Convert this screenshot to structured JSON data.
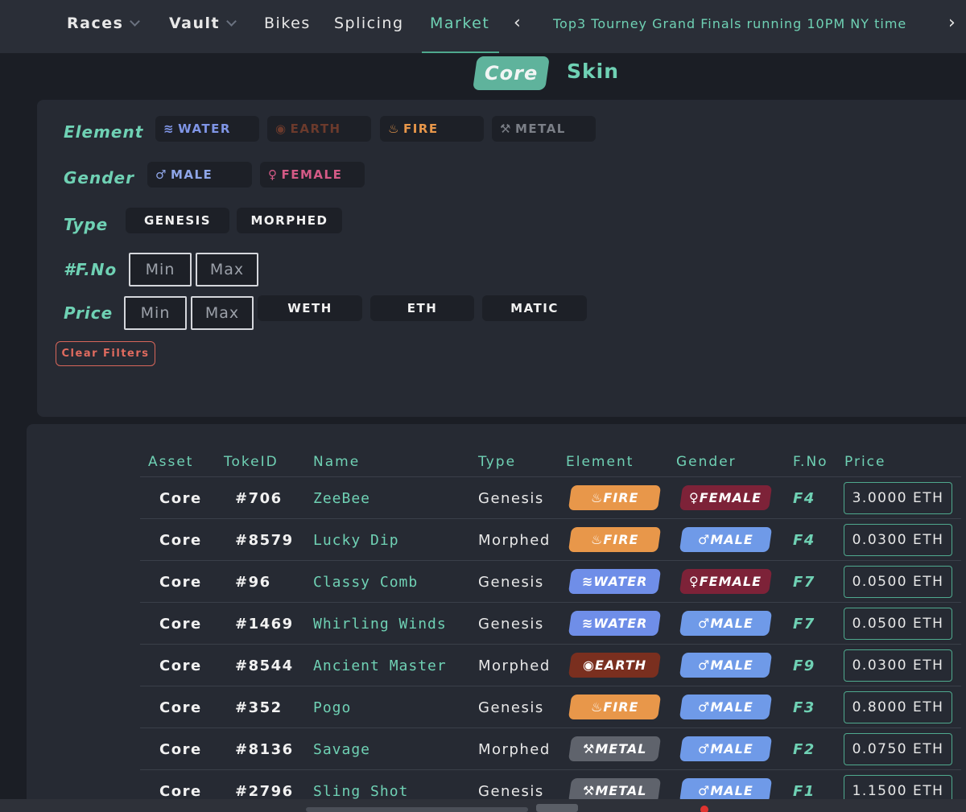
{
  "nav": {
    "races": "Races",
    "vault": "Vault",
    "bikes": "Bikes",
    "splicing": "Splicing",
    "market": "Market",
    "prev": "‹",
    "next": "›",
    "ticker": "Top3 Tourney Grand Finals running 10PM NY time"
  },
  "toggle": {
    "core": "Core",
    "skin": "Skin"
  },
  "filters": {
    "element_label": "Element",
    "gender_label": "Gender",
    "type_label": "Type",
    "fno_label": "#F.No",
    "price_label": "Price",
    "elements": [
      {
        "label": "WATER",
        "icon": "≋",
        "color": "#7f95e6"
      },
      {
        "label": "EARTH",
        "icon": "◉",
        "color": "#6b3a2c"
      },
      {
        "label": "FIRE",
        "icon": "♨",
        "color": "#e8974a"
      },
      {
        "label": "METAL",
        "icon": "⚒",
        "color": "#7b7f87"
      }
    ],
    "genders": [
      {
        "label": "MALE",
        "icon": "♂",
        "color": "#8fa6e8"
      },
      {
        "label": "FEMALE",
        "icon": "♀",
        "color": "#d45a86"
      }
    ],
    "types": [
      "GENESIS",
      "MORPHED"
    ],
    "min_placeholder": "Min",
    "max_placeholder": "Max",
    "currencies": [
      "WETH",
      "ETH",
      "MATIC"
    ],
    "clear": "Clear Filters"
  },
  "table": {
    "headers": [
      "Asset",
      "TokeID",
      "Name",
      "Type",
      "Element",
      "Gender",
      "F.No",
      "Price"
    ],
    "rows": [
      {
        "asset": "Core",
        "id": "#706",
        "name": "ZeeBee",
        "type": "Genesis",
        "element": "FIRE",
        "gender": "FEMALE",
        "fno": "F4",
        "price": "3.0000 ETH"
      },
      {
        "asset": "Core",
        "id": "#8579",
        "name": "Lucky Dip",
        "type": "Morphed",
        "element": "FIRE",
        "gender": "MALE",
        "fno": "F4",
        "price": "0.0300 ETH"
      },
      {
        "asset": "Core",
        "id": "#96",
        "name": "Classy Comb",
        "type": "Genesis",
        "element": "WATER",
        "gender": "FEMALE",
        "fno": "F7",
        "price": "0.0500 ETH"
      },
      {
        "asset": "Core",
        "id": "#1469",
        "name": "Whirling Winds",
        "type": "Genesis",
        "element": "WATER",
        "gender": "MALE",
        "fno": "F7",
        "price": "0.0500 ETH"
      },
      {
        "asset": "Core",
        "id": "#8544",
        "name": "Ancient Master",
        "type": "Morphed",
        "element": "EARTH",
        "gender": "MALE",
        "fno": "F9",
        "price": "0.0300 ETH"
      },
      {
        "asset": "Core",
        "id": "#352",
        "name": "Pogo",
        "type": "Genesis",
        "element": "FIRE",
        "gender": "MALE",
        "fno": "F3",
        "price": "0.8000 ETH"
      },
      {
        "asset": "Core",
        "id": "#8136",
        "name": "Savage",
        "type": "Morphed",
        "element": "METAL",
        "gender": "MALE",
        "fno": "F2",
        "price": "0.0750 ETH"
      },
      {
        "asset": "Core",
        "id": "#2796",
        "name": "Sling Shot",
        "type": "Genesis",
        "element": "METAL",
        "gender": "MALE",
        "fno": "F1",
        "price": "1.1500 ETH"
      }
    ]
  },
  "badge_colors": {
    "FIRE": "#e8974a",
    "WATER": "#6f8ee8",
    "EARTH": "#7a2f1f",
    "METAL": "#5f636c",
    "MALE": "#6f9ae8",
    "FEMALE": "#7d2238"
  },
  "badge_icons": {
    "FIRE": "♨",
    "WATER": "≋",
    "EARTH": "◉",
    "METAL": "⚒",
    "MALE": "♂",
    "FEMALE": "♀"
  }
}
